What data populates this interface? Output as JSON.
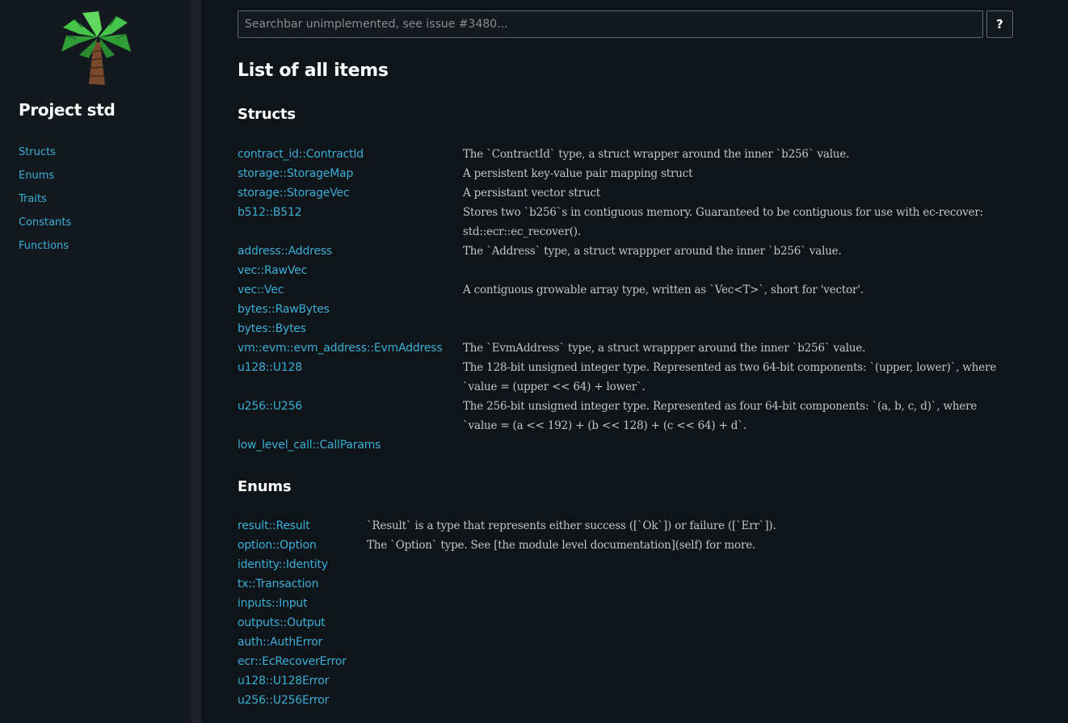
{
  "sidebar": {
    "project_title": "Project std",
    "nav": [
      "Structs",
      "Enums",
      "Traits",
      "Constants",
      "Functions"
    ]
  },
  "search": {
    "placeholder": "Searchbar unimplemented, see issue #3480...",
    "help_label": "?"
  },
  "page": {
    "title": "List of all items"
  },
  "sections": {
    "structs": {
      "title": "Structs",
      "items": [
        {
          "name": "contract_id::ContractId",
          "desc": "The `ContractId` type, a struct wrapper around the inner `b256` value."
        },
        {
          "name": "storage::StorageMap",
          "desc": "A persistent key-value pair mapping struct"
        },
        {
          "name": "storage::StorageVec",
          "desc": "A persistant vector struct"
        },
        {
          "name": "b512::B512",
          "desc": "Stores two `b256`s in contiguous memory. Guaranteed to be contiguous for use with ec-recover: std::ecr::ec_recover()."
        },
        {
          "name": "address::Address",
          "desc": "The `Address` type, a struct wrappper around the inner `b256` value."
        },
        {
          "name": "vec::RawVec",
          "desc": ""
        },
        {
          "name": "vec::Vec",
          "desc": "A contiguous growable array type, written as `Vec<T>`, short for 'vector'."
        },
        {
          "name": "bytes::RawBytes",
          "desc": ""
        },
        {
          "name": "bytes::Bytes",
          "desc": ""
        },
        {
          "name": "vm::evm::evm_address::EvmAddress",
          "desc": "The `EvmAddress` type, a struct wrappper around the inner `b256` value."
        },
        {
          "name": "u128::U128",
          "desc": "The 128-bit unsigned integer type. Represented as two 64-bit components: `(upper, lower)`, where `value = (upper << 64) + lower`."
        },
        {
          "name": "u256::U256",
          "desc": "The 256-bit unsigned integer type. Represented as four 64-bit components: `(a, b, c, d)`, where `value = (a << 192) + (b << 128) + (c << 64) + d`."
        },
        {
          "name": "low_level_call::CallParams",
          "desc": ""
        }
      ]
    },
    "enums": {
      "title": "Enums",
      "items": [
        {
          "name": "result::Result",
          "desc": "`Result` is a type that represents either success ([`Ok`]) or failure ([`Err`])."
        },
        {
          "name": "option::Option",
          "desc": "The `Option` type. See [the module level documentation](self) for more."
        },
        {
          "name": "identity::Identity",
          "desc": ""
        },
        {
          "name": "tx::Transaction",
          "desc": ""
        },
        {
          "name": "inputs::Input",
          "desc": ""
        },
        {
          "name": "outputs::Output",
          "desc": ""
        },
        {
          "name": "auth::AuthError",
          "desc": ""
        },
        {
          "name": "ecr::EcRecoverError",
          "desc": ""
        },
        {
          "name": "u128::U128Error",
          "desc": ""
        },
        {
          "name": "u256::U256Error",
          "desc": ""
        }
      ]
    }
  },
  "icons": {
    "logo": "palm-tree-logo-icon"
  },
  "colors": {
    "link": "#39afd7",
    "heading": "#ffffff",
    "body_text": "#c5c5c5",
    "sidebar_bg": "#14191f",
    "main_bg": "#0f1419"
  }
}
